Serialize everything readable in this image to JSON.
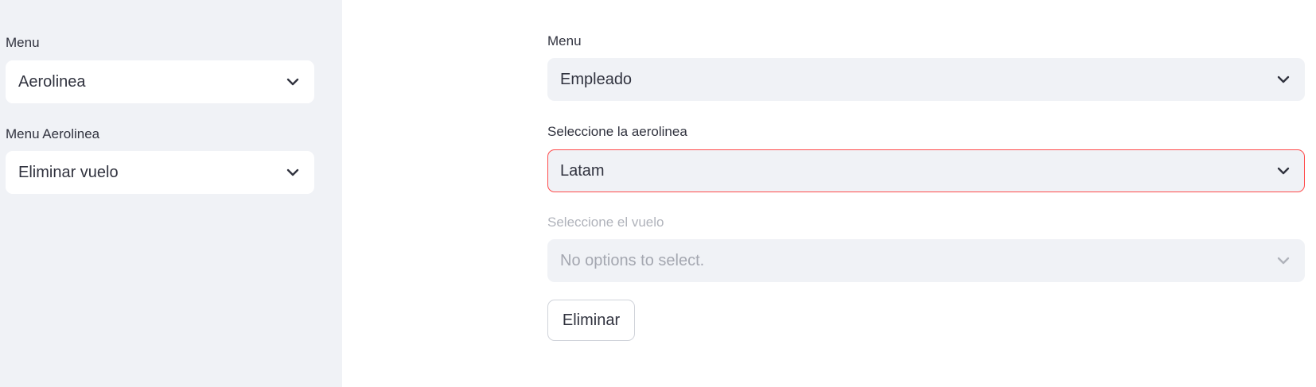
{
  "sidebar": {
    "menu_label": "Menu",
    "menu_value": "Aerolinea",
    "submenu_label": "Menu Aerolinea",
    "submenu_value": "Eliminar vuelo"
  },
  "main": {
    "menu_label": "Menu",
    "menu_value": "Empleado",
    "airline_label": "Seleccione la aerolinea",
    "airline_value": "Latam",
    "flight_label": "Seleccione el vuelo",
    "flight_placeholder": "No options to select.",
    "delete_button": "Eliminar"
  },
  "colors": {
    "sidebar_bg": "#f0f2f6",
    "text": "#31333f",
    "error_border": "#ff4b4b",
    "disabled_text": "#a4a7b0"
  },
  "icons": {
    "select_chevron": "chevron-down-icon"
  }
}
